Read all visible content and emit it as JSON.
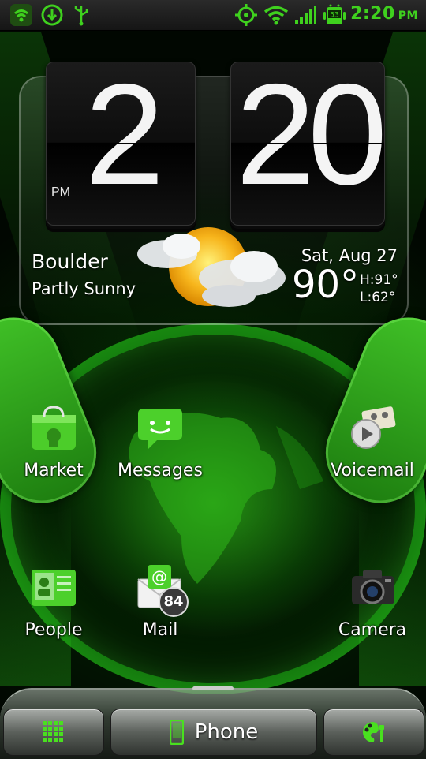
{
  "status_bar": {
    "time": "2:20",
    "ampm": "PM",
    "battery_level": "53",
    "icons": [
      "shield-icon",
      "download-icon",
      "usb-icon",
      "gps-icon",
      "wifi-icon",
      "signal-icon",
      "battery-icon"
    ],
    "accent_color": "#3fd11e"
  },
  "clock_widget": {
    "hour": "2",
    "minute": "20",
    "ampm": "PM",
    "city": "Boulder",
    "condition": "Partly Sunny",
    "date": "Sat, Aug 27",
    "temperature": "90°",
    "high": "H:91°",
    "low": "L:62°",
    "weather_icon": "partly-sunny-icon"
  },
  "apps": [
    {
      "label": "Market",
      "icon": "market-icon"
    },
    {
      "label": "Messages",
      "icon": "messages-icon"
    },
    {
      "label": "Voicemail",
      "icon": "voicemail-icon"
    },
    {
      "label": "People",
      "icon": "people-icon"
    },
    {
      "label": "Mail",
      "icon": "mail-icon",
      "badge": "84"
    },
    {
      "label": "Camera",
      "icon": "camera-icon"
    }
  ],
  "dock": {
    "left_icon": "app-drawer-icon",
    "center_label": "Phone",
    "center_icon": "phone-icon",
    "right_icon": "personalize-icon"
  }
}
